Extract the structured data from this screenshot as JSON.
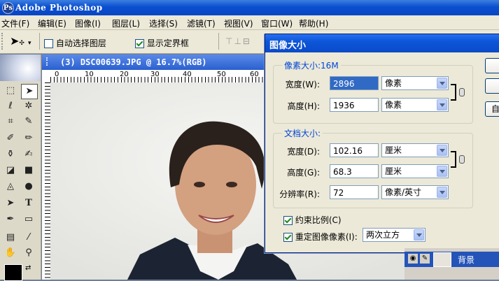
{
  "app": {
    "title": "Adobe Photoshop"
  },
  "menu": [
    "文件(F)",
    "编辑(E)",
    "图像(I)",
    "图层(L)",
    "选择(S)",
    "滤镜(T)",
    "视图(V)",
    "窗口(W)",
    "帮助(H)"
  ],
  "options": {
    "auto_select_label": "自动选择图层",
    "auto_select_checked": false,
    "show_bounds_label": "显示定界框",
    "show_bounds_checked": true
  },
  "document": {
    "title": "(3) DSC00639.JPG @ 16.7%(RGB)",
    "ruler_ticks": [
      "0",
      "10",
      "20",
      "30",
      "40",
      "50",
      "60"
    ]
  },
  "dialog": {
    "title": "图像大小",
    "pixel_dims": {
      "group_label": "像素大小:16M",
      "width_label": "宽度(W):",
      "width_value": "2896",
      "width_unit": "像素",
      "height_label": "高度(H):",
      "height_value": "1936",
      "height_unit": "像素"
    },
    "doc_size": {
      "group_label": "文档大小:",
      "width_label": "宽度(D):",
      "width_value": "102.16",
      "width_unit": "厘米",
      "height_label": "高度(G):",
      "height_value": "68.3",
      "height_unit": "厘米",
      "res_label": "分辨率(R):",
      "res_value": "72",
      "res_unit": "像素/英寸"
    },
    "constrain_label": "约束比例(C)",
    "constrain_checked": true,
    "resample_label": "重定图像像素(I):",
    "resample_checked": true,
    "resample_method": "两次立方",
    "auto_button_label": "自"
  },
  "layers": {
    "layer_name": "背景"
  }
}
